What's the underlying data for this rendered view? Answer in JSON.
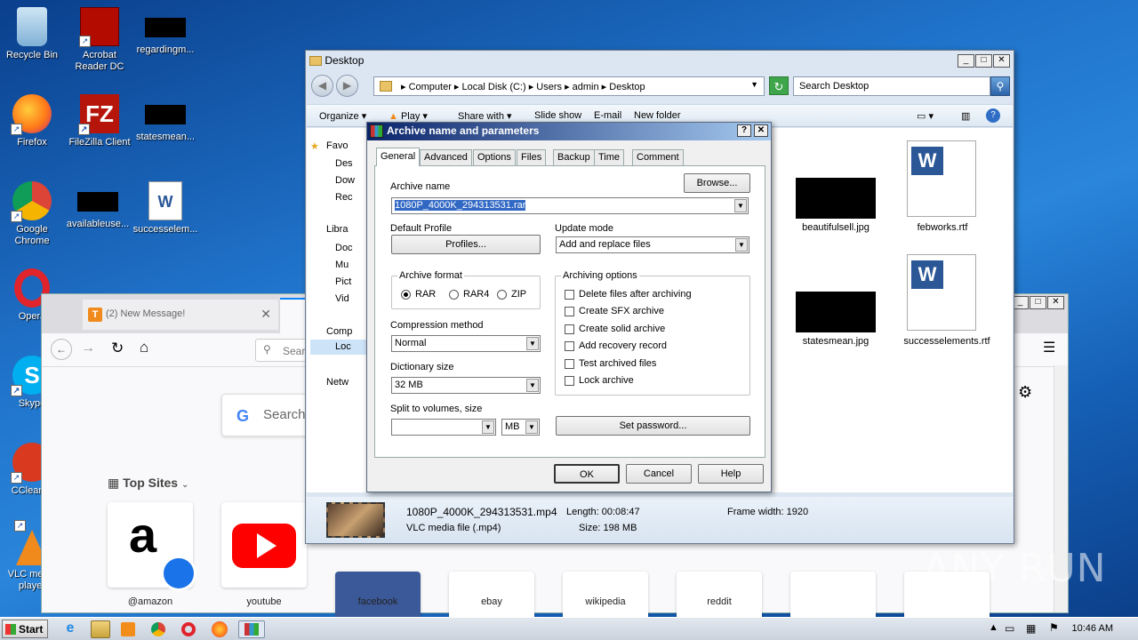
{
  "desktop": {
    "icons": [
      {
        "label": "Recycle Bin"
      },
      {
        "label": "Acrobat Reader DC"
      },
      {
        "label": "regardingm..."
      },
      {
        "label": "Firefox"
      },
      {
        "label": "FileZilla Client"
      },
      {
        "label": "statesmean..."
      },
      {
        "label": "Google Chrome"
      },
      {
        "label": "availableuse..."
      },
      {
        "label": "successelem..."
      },
      {
        "label": "Opera"
      },
      {
        "label": "Skype"
      },
      {
        "label": "CCleaner"
      },
      {
        "label": "VLC media player"
      }
    ]
  },
  "firefox": {
    "tab_title": "(2) New Message!",
    "search_placeholder": "Sear",
    "google_search": "Search",
    "top_sites_label": "Top Sites",
    "tiles": [
      "@amazon",
      "youtube",
      "facebook",
      "ebay",
      "wikipedia",
      "reddit"
    ]
  },
  "explorer": {
    "title": "Desktop",
    "breadcrumb": [
      "Computer",
      "Local Disk (C:)",
      "Users",
      "admin",
      "Desktop"
    ],
    "search_placeholder": "Search Desktop",
    "toolbar": {
      "organize": "Organize",
      "play": "Play",
      "share_with": "Share with",
      "slide_show": "Slide show",
      "email": "E-mail",
      "new_folder": "New folder"
    },
    "nav": [
      "Favo",
      "Des",
      "Dow",
      "Rec",
      "Libra",
      "Doc",
      "Mu",
      "Pict",
      "Vid",
      "Comp",
      "Loc",
      "Netw"
    ],
    "files": [
      {
        "name": "beautifulsell.jpg"
      },
      {
        "name": "febworks.rtf"
      },
      {
        "name": "statesmean.jpg"
      },
      {
        "name": "successelements.rtf"
      }
    ],
    "status": {
      "filename": "1080P_4000K_294313531.mp4",
      "filetype": "VLC media file (.mp4)",
      "length": "Length: 00:08:47",
      "size": "Size: 198 MB",
      "frame_width": "Frame width: 1920"
    }
  },
  "dialog": {
    "title": "Archive name and parameters",
    "tabs": [
      "General",
      "Advanced",
      "Options",
      "Files",
      "Backup",
      "Time",
      "Comment"
    ],
    "archive_name_label": "Archive name",
    "browse": "Browse...",
    "archive_name": "1080P_4000K_294313531.rar",
    "default_profile_label": "Default Profile",
    "profiles_button": "Profiles...",
    "update_mode_label": "Update mode",
    "update_mode": "Add and replace files",
    "archive_format_label": "Archive format",
    "formats": [
      "RAR",
      "RAR4",
      "ZIP"
    ],
    "selected_format": "RAR",
    "compression_method_label": "Compression method",
    "compression_method": "Normal",
    "dictionary_size_label": "Dictionary size",
    "dictionary_size": "32 MB",
    "split_label": "Split to volumes, size",
    "split_value": "",
    "split_unit": "MB",
    "archiving_options_label": "Archiving options",
    "options": [
      "Delete files after archiving",
      "Create SFX archive",
      "Create solid archive",
      "Add recovery record",
      "Test archived files",
      "Lock archive"
    ],
    "set_password": "Set password...",
    "ok": "OK",
    "cancel": "Cancel",
    "help": "Help"
  },
  "taskbar": {
    "start": "Start",
    "clock": "10:46 AM"
  },
  "watermark": "ANY RUN"
}
